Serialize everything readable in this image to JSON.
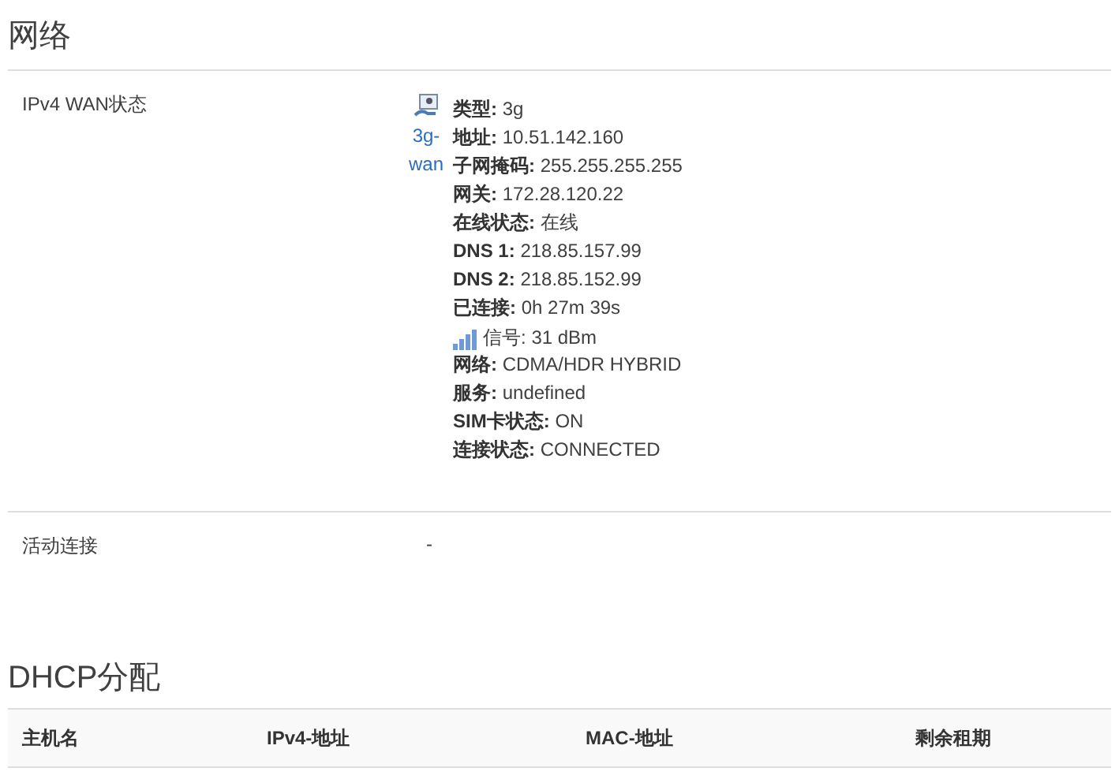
{
  "network": {
    "title": "网络",
    "rows": [
      {
        "label": "IPv4 WAN状态",
        "interface": {
          "name_lines": [
            "3g-",
            "wan"
          ]
        },
        "details": [
          {
            "kind": "field",
            "label": "类型:",
            "value": "3g"
          },
          {
            "kind": "field",
            "label": "地址:",
            "value": "10.51.142.160"
          },
          {
            "kind": "field",
            "label": "子网掩码:",
            "value": "255.255.255.255"
          },
          {
            "kind": "field",
            "label": "网关:",
            "value": "172.28.120.22"
          },
          {
            "kind": "field",
            "label": "在线状态:",
            "value": "在线"
          },
          {
            "kind": "field",
            "label": "DNS 1:",
            "value": "218.85.157.99"
          },
          {
            "kind": "field",
            "label": "DNS 2:",
            "value": "218.85.152.99"
          },
          {
            "kind": "field",
            "label": "已连接:",
            "value": "0h 27m 39s"
          },
          {
            "kind": "signal",
            "label": "信号:",
            "value": "31 dBm"
          },
          {
            "kind": "field",
            "label": "网络:",
            "value": "CDMA/HDR HYBRID"
          },
          {
            "kind": "field",
            "label": "服务:",
            "value": "undefined"
          },
          {
            "kind": "field",
            "label": "SIM卡状态:",
            "value": "ON"
          },
          {
            "kind": "field",
            "label": "连接状态:",
            "value": "CONNECTED"
          }
        ]
      },
      {
        "label": "活动连接",
        "value": "-"
      }
    ]
  },
  "dhcp": {
    "title": "DHCP分配",
    "table": {
      "columns": [
        "主机名",
        "IPv4-地址",
        "MAC-地址",
        "剩余租期"
      ]
    }
  }
}
